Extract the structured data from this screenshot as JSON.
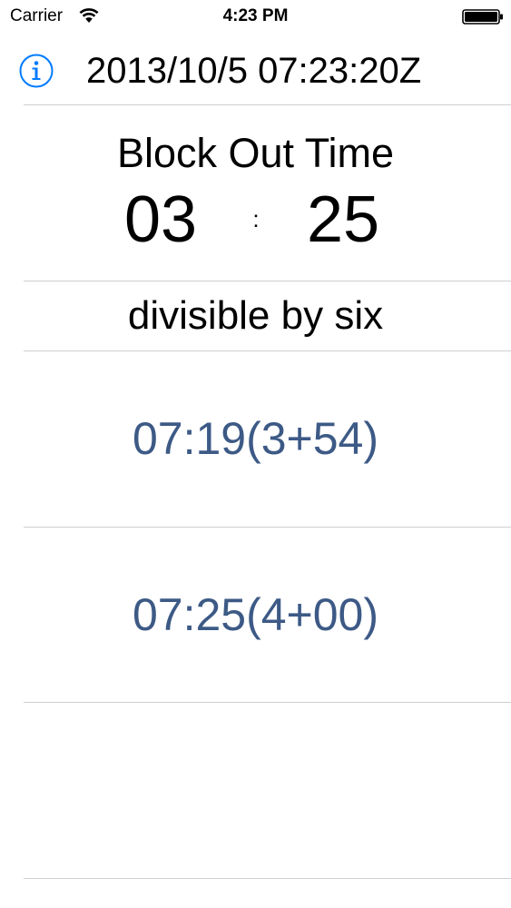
{
  "status_bar": {
    "carrier": "Carrier",
    "time": "4:23 PM",
    "icons": [
      "wifi-icon",
      "battery-icon"
    ]
  },
  "header": {
    "info_icon": "info-icon",
    "datetime": "2013/10/5 07:23:20Z"
  },
  "block_out": {
    "title": "Block Out Time",
    "hours": "03",
    "separator": ":",
    "minutes": "25"
  },
  "rule": {
    "label": "divisible by six"
  },
  "results": [
    {
      "label": "07:19(3+54)"
    },
    {
      "label": "07:25(4+00)"
    }
  ],
  "colors": {
    "accent": "#007aff",
    "result_text": "#3d5a86",
    "divider": "#cfcfd3"
  }
}
